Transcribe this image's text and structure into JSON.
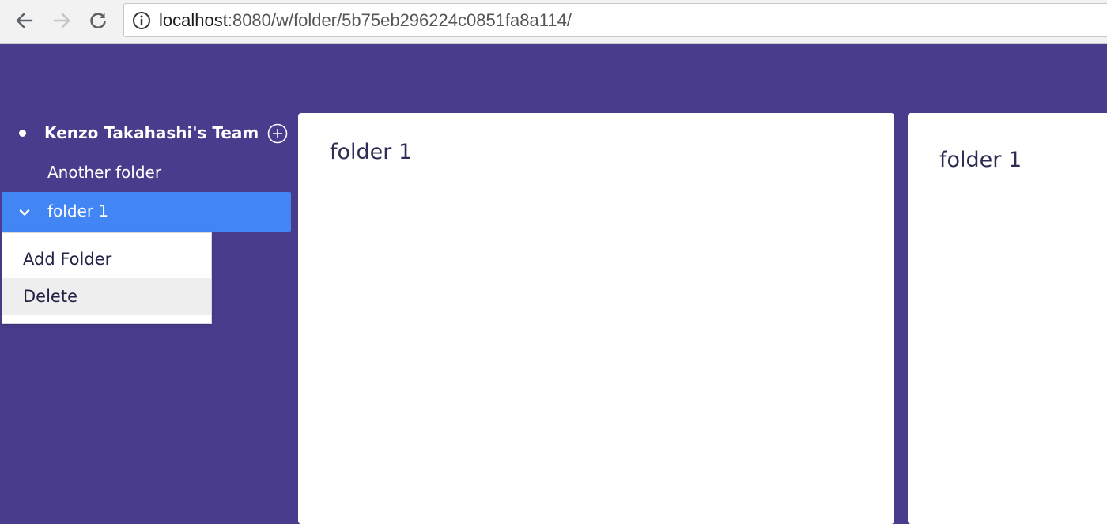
{
  "browser": {
    "url_host": "localhost",
    "url_path": ":8080/w/folder/5b75eb296224c0851fa8a114/",
    "icons": [
      "arrow-left-icon",
      "arrow-right-icon",
      "reload-icon",
      "info-icon"
    ]
  },
  "sidebar": {
    "team_name": "Kenzo Takahashi's Team",
    "folders": [
      {
        "label": "Another folder",
        "selected": false
      },
      {
        "label": "folder 1",
        "selected": true
      }
    ]
  },
  "context_menu": {
    "items": [
      {
        "label": "Add Folder"
      },
      {
        "label": "Delete",
        "highlighted": true
      }
    ]
  },
  "panels": [
    {
      "title": "folder 1"
    },
    {
      "title": "folder 1"
    }
  ],
  "colors": {
    "background": "#4a3c8c",
    "selected": "#4285f4",
    "panel": "#ffffff"
  }
}
